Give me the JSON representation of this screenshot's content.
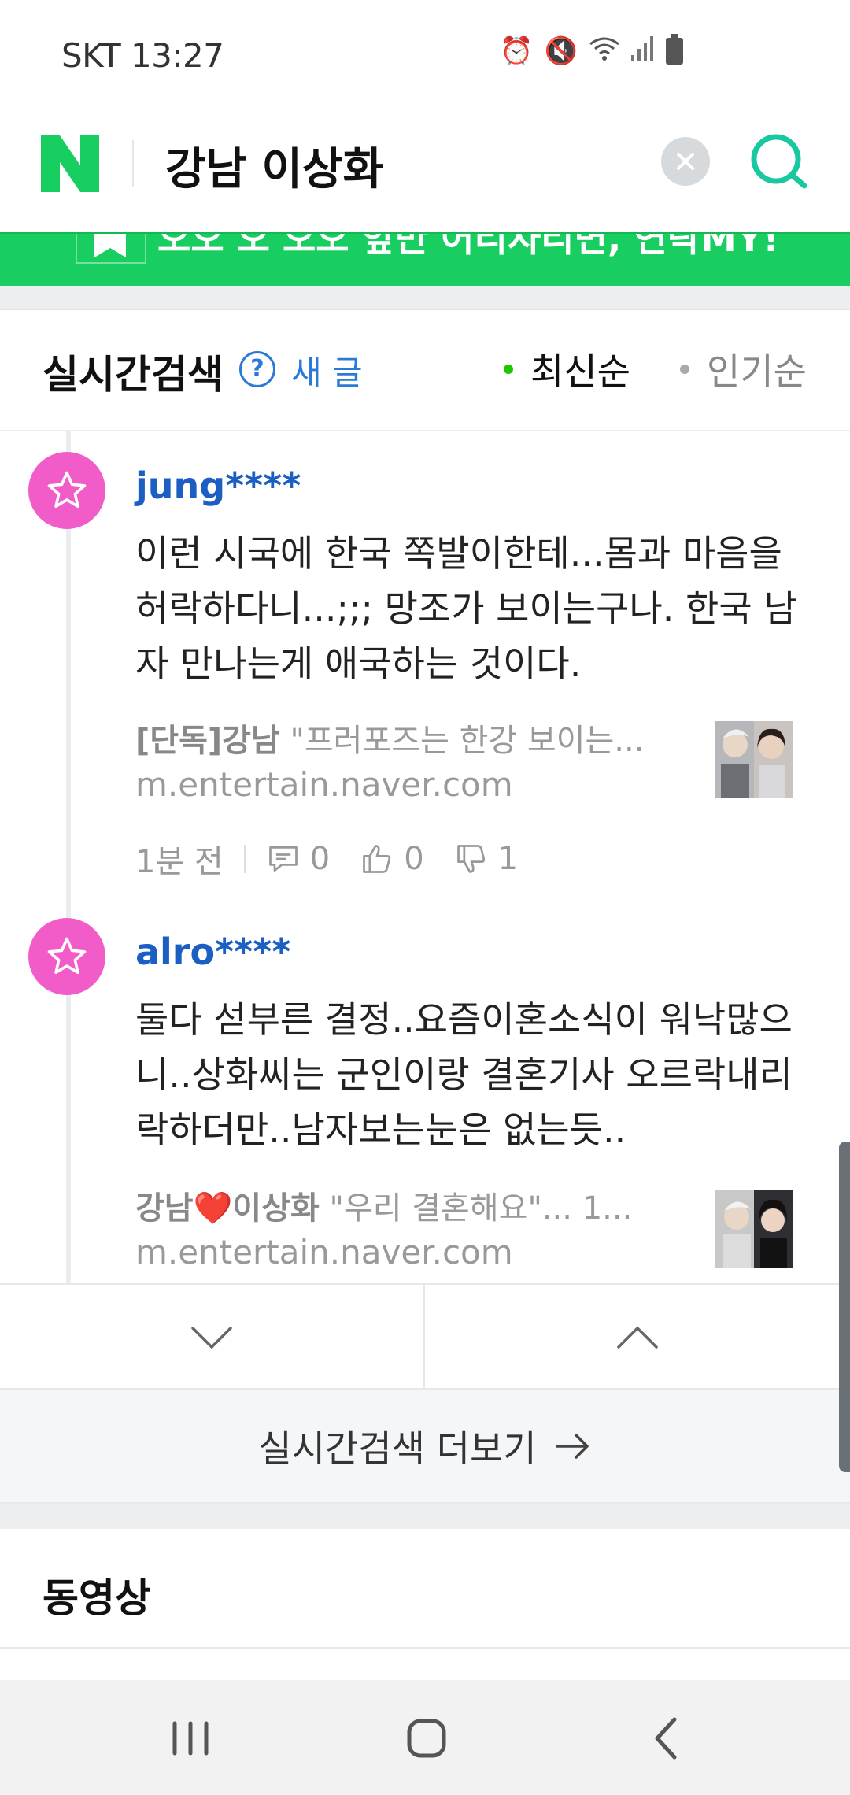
{
  "status_bar": {
    "carrier_time": "SKT 13:27",
    "icons": [
      "alarm-icon",
      "mute-icon",
      "wifi-icon",
      "signal-icon",
      "battery-icon"
    ]
  },
  "search": {
    "logo": "N",
    "query": "강남 이상화",
    "clear_icon": "close-icon",
    "search_icon": "search-icon"
  },
  "banner": {
    "text": "오오 오 오오 앞만 어리자리면, 연락MY!"
  },
  "realtime": {
    "title": "실시간검색",
    "help_icon": "question-icon",
    "new_label": "새 글",
    "sort_latest": "최신순",
    "sort_popular": "인기순",
    "items": [
      {
        "username": "jung****",
        "comment": "이런 시국에 한국 쪽발이한테...몸과 마음을 허락하다니...;;; 망조가 보이는구나. 한국 남자 만나는게 애국하는 것이다.",
        "link_title_bold": "[단독]강남",
        "link_title_rest": " \"프러포즈는 한강 보이는...",
        "link_url": "m.entertain.naver.com",
        "time": "1분 전",
        "replies": "0",
        "likes": "0",
        "dislikes": "1"
      },
      {
        "username": "alro****",
        "comment": "둘다 섣부른 결정..요즘이혼소식이 워낙많으니..상화씨는 군인이랑 결혼기사 오르락내리락하더만..남자보는눈은 없는듯..",
        "link_title_bold": "강남❤️이상화",
        "link_title_rest": " \"우리 결혼해요\"... 1...",
        "link_url": "m.entertain.naver.com"
      }
    ],
    "more_label": "실시간검색 더보기"
  },
  "video": {
    "title": "동영상"
  },
  "colors": {
    "naver_green": "#19ce60",
    "link_blue": "#1b5fc2",
    "avatar_pink": "#f25cc8"
  }
}
